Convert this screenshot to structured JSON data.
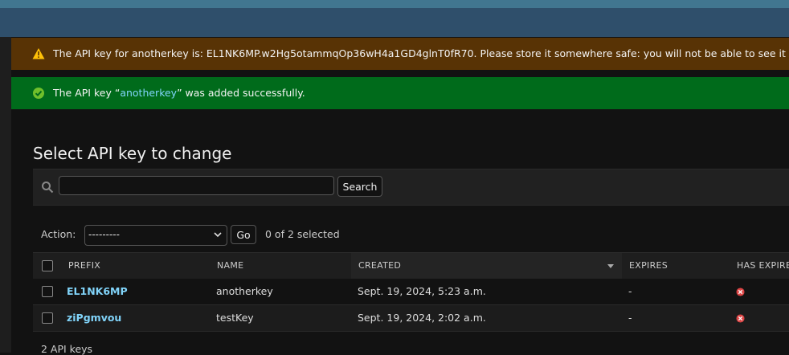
{
  "messages": {
    "warning": {
      "text": "The API key for anotherkey is: EL1NK6MP.w2Hg5otammqOp36wH4a1GD4glnT0fR70. Please store it somewhere safe: you will not be able to see it again.",
      "icon": "warning-icon",
      "color": "#583305"
    },
    "success": {
      "prefix": "The API key “",
      "link": "anotherkey",
      "suffix": "” was added successfully.",
      "icon": "check-circle-icon",
      "color": "#006b1b"
    }
  },
  "page_title": "Select API key to change",
  "search": {
    "value": "",
    "button_label": "Search"
  },
  "actions": {
    "label": "Action:",
    "selected_option": "---------",
    "go_label": "Go",
    "selected_count": "0 of 2 selected"
  },
  "table": {
    "columns": [
      "PREFIX",
      "NAME",
      "CREATED",
      "EXPIRES",
      "HAS EXPIRED"
    ],
    "rows": [
      {
        "prefix": "EL1NK6MP",
        "name": "anotherkey",
        "created": "Sept. 19, 2024, 5:23 a.m.",
        "expires": "-",
        "has_expired": "false"
      },
      {
        "prefix": "ziPgmvou",
        "name": "testKey",
        "created": "Sept. 19, 2024, 2:02 a.m.",
        "expires": "-",
        "has_expired": "false"
      }
    ]
  },
  "footer_count": "2 API keys",
  "colors": {
    "accent_link": "#81d4fa",
    "header": "#2f4f6b"
  }
}
